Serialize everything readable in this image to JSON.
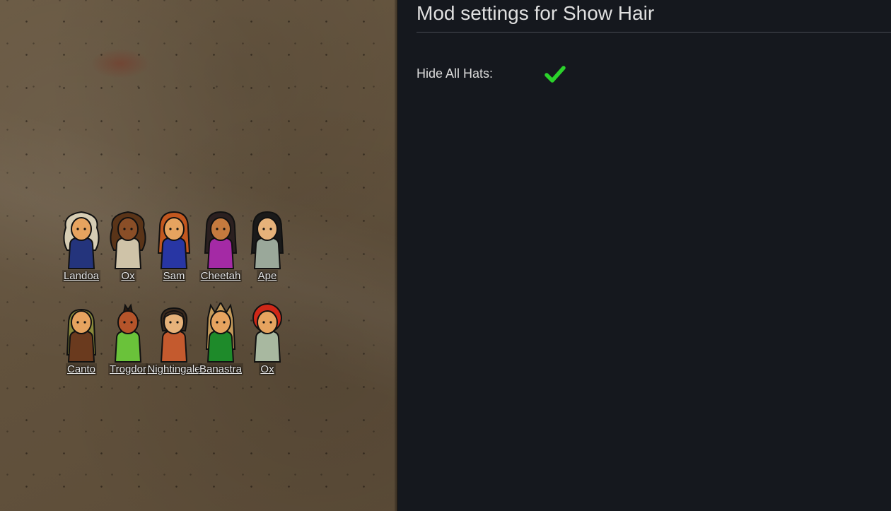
{
  "settings": {
    "title": "Mod settings for Show Hair",
    "options": [
      {
        "label": "Hide All Hats:",
        "checked": true,
        "check_icon": "checkmark-icon",
        "check_color": "#2bd22b"
      }
    ]
  },
  "colonists": [
    {
      "name": "Landoa",
      "hair": "#d6cdb4",
      "skin": "#e6a35f",
      "shirt": "#24347c",
      "hair_style": "long-wild"
    },
    {
      "name": "Ox",
      "hair": "#5a3418",
      "skin": "#8a4e27",
      "shirt": "#cfc3a8",
      "hair_style": "long-wild"
    },
    {
      "name": "Sam",
      "hair": "#c2571f",
      "skin": "#e6a35f",
      "shirt": "#2836a4",
      "hair_style": "long"
    },
    {
      "name": "Cheetah",
      "hair": "#2b2020",
      "skin": "#c47a3e",
      "shirt": "#a42aa5",
      "hair_style": "long"
    },
    {
      "name": "Ape",
      "hair": "#1a1a1a",
      "skin": "#e6b27a",
      "shirt": "#9aa89a",
      "hair_style": "long"
    },
    {
      "name": "Canto",
      "hair": "#8a8a3a",
      "skin": "#e6a35f",
      "shirt": "#6a3a1e",
      "hair_style": "hood"
    },
    {
      "name": "Trogdor",
      "hair": "#2a1a10",
      "skin": "#b5542a",
      "shirt": "#6ac23a",
      "hair_style": "mohawk"
    },
    {
      "name": "Nightingale",
      "hair": "#3a2a1e",
      "skin": "#e6b27a",
      "shirt": "#c45a2e",
      "hair_style": "shaggy"
    },
    {
      "name": "Banastra",
      "hair": "#c49a5a",
      "skin": "#e6a35f",
      "shirt": "#1e8a2a",
      "hair_style": "spiky-long"
    },
    {
      "name": "Ox",
      "hair": "#d02818",
      "skin": "#e6a35f",
      "shirt": "#a8b8a0",
      "hair_style": "afro"
    }
  ]
}
